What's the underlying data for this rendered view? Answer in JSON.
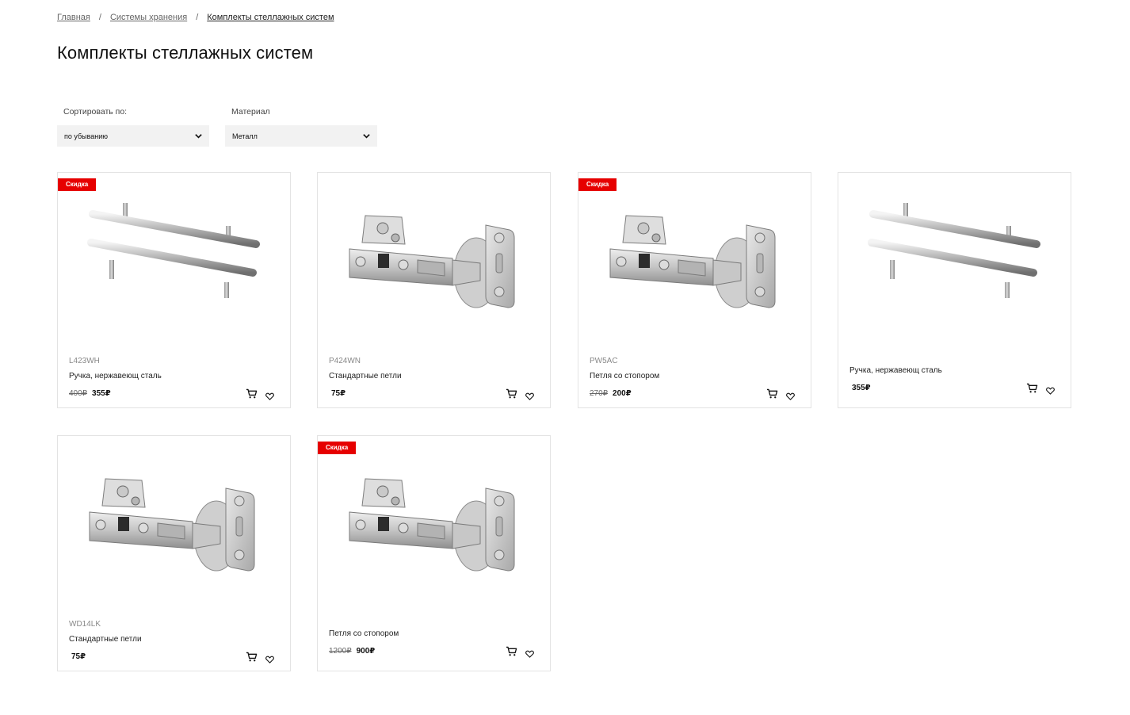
{
  "breadcrumb": {
    "home": "Главная",
    "storage": "Системы хранения",
    "current": "Комплекты стеллажных систем",
    "separator": "/"
  },
  "page_title": "Комплекты стеллажных систем",
  "filters": {
    "sort": {
      "label": "Сортировать по:",
      "value": "по убыванию"
    },
    "material": {
      "label": "Материал",
      "value": "Металл"
    }
  },
  "badge_text": "Скидка",
  "currency": "₽",
  "products": [
    {
      "badge": "Скидка",
      "code": "L423WH",
      "name": "Ручка, нержавеющ сталь",
      "old_price": "400₽",
      "price": "355₽",
      "image": "handle"
    },
    {
      "badge": "",
      "code": "P424WN",
      "name": "Стандартные петли",
      "old_price": "",
      "price": "75₽",
      "image": "hinge"
    },
    {
      "badge": "Скидка",
      "code": "PW5AC",
      "name": "Петля со стопором",
      "old_price": "270₽",
      "price": "200₽",
      "image": "hinge"
    },
    {
      "badge": "",
      "code": "",
      "name": "Ручка, нержавеющ сталь",
      "old_price": "",
      "price": "355₽",
      "image": "handle"
    },
    {
      "badge": "",
      "code": "WD14LK",
      "name": "Стандартные петли",
      "old_price": "",
      "price": "75₽",
      "image": "hinge"
    },
    {
      "badge": "Скидка",
      "code": "",
      "name": "Петля со стопором",
      "old_price": "1200₽",
      "price": "900₽",
      "image": "hinge"
    }
  ],
  "icons": {
    "cart": "cart-icon",
    "favorite": "heart-icon",
    "dropdown": "chevron-down-icon"
  },
  "colors": {
    "badge": "#e60000",
    "select_bg": "#f2f2f2",
    "card_border": "#e3e3e3"
  }
}
